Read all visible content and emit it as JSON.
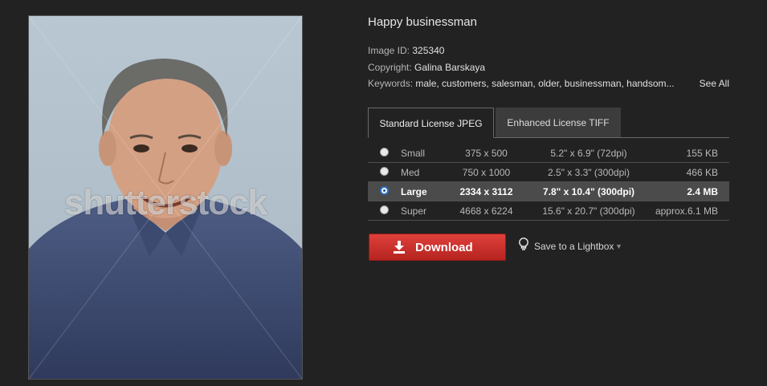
{
  "image": {
    "title": "Happy businessman",
    "watermark": "shutterstock",
    "id_label": "Image ID:",
    "id_value": "325340",
    "copyright_label": "Copyright:",
    "copyright_value": "Galina Barskaya",
    "keywords_label": "Keywords:",
    "keywords_value": "male, customers, salesman, older, businessman, handsom...",
    "see_all": "See All"
  },
  "tabs": [
    {
      "label": "Standard License JPEG",
      "active": true
    },
    {
      "label": "Enhanced License TIFF",
      "active": false
    }
  ],
  "sizes": [
    {
      "name": "Small",
      "pixels": "375 x 500",
      "inches": "5.2\" x 6.9\"  (72dpi)",
      "filesize": "155 KB",
      "selected": false
    },
    {
      "name": "Med",
      "pixels": "750 x 1000",
      "inches": "2.5\" x 3.3\"  (300dpi)",
      "filesize": "466 KB",
      "selected": false
    },
    {
      "name": "Large",
      "pixels": "2334 x 3112",
      "inches": "7.8\" x 10.4\"  (300dpi)",
      "filesize": "2.4 MB",
      "selected": true
    },
    {
      "name": "Super",
      "pixels": "4668 x 6224",
      "inches": "15.6\" x 20.7\"  (300dpi)",
      "filesize": "approx.6.1 MB",
      "selected": false
    }
  ],
  "actions": {
    "download_label": "Download",
    "lightbox_label": "Save to a Lightbox"
  },
  "icons": {
    "download": "download-arrow-icon",
    "lightbox": "lightbulb-icon",
    "caret": "caret-down-icon"
  },
  "colors": {
    "background": "#222222",
    "download_button": "#d2322d",
    "selected_row": "#4b4b4b"
  }
}
